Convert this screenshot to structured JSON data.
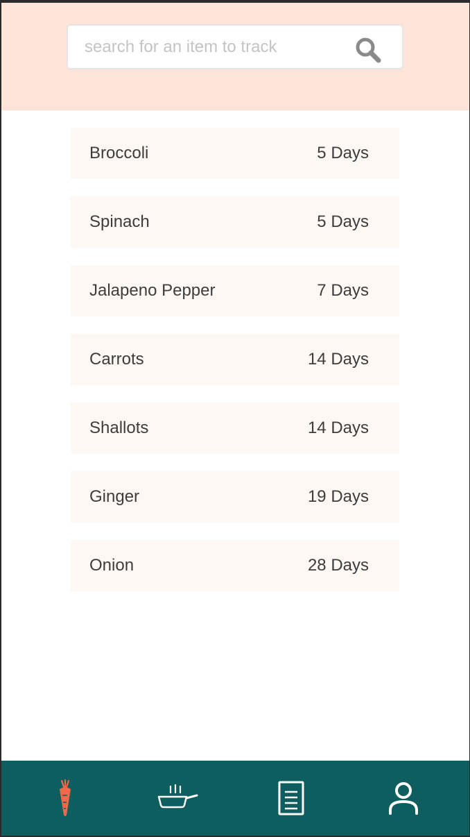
{
  "search": {
    "placeholder": "search for an item to track",
    "value": ""
  },
  "items": [
    {
      "name": "Broccoli",
      "days": "5 Days"
    },
    {
      "name": "Spinach",
      "days": "5 Days"
    },
    {
      "name": "Jalapeno Pepper",
      "days": "7 Days"
    },
    {
      "name": "Carrots",
      "days": "14 Days"
    },
    {
      "name": "Shallots",
      "days": "14 Days"
    },
    {
      "name": "Ginger",
      "days": "19 Days"
    },
    {
      "name": "Onion",
      "days": "28 Days"
    }
  ],
  "nav": {
    "items": [
      {
        "icon": "carrot-icon",
        "active": true
      },
      {
        "icon": "frying-pan-icon",
        "active": false
      },
      {
        "icon": "document-icon",
        "active": false
      },
      {
        "icon": "user-icon",
        "active": false
      }
    ]
  },
  "colors": {
    "header_bg": "#fde3d8",
    "item_bg": "#fdf8f4",
    "nav_bg": "#0f5e5f",
    "accent": "#f06a4a",
    "text": "#3d3d3d"
  }
}
